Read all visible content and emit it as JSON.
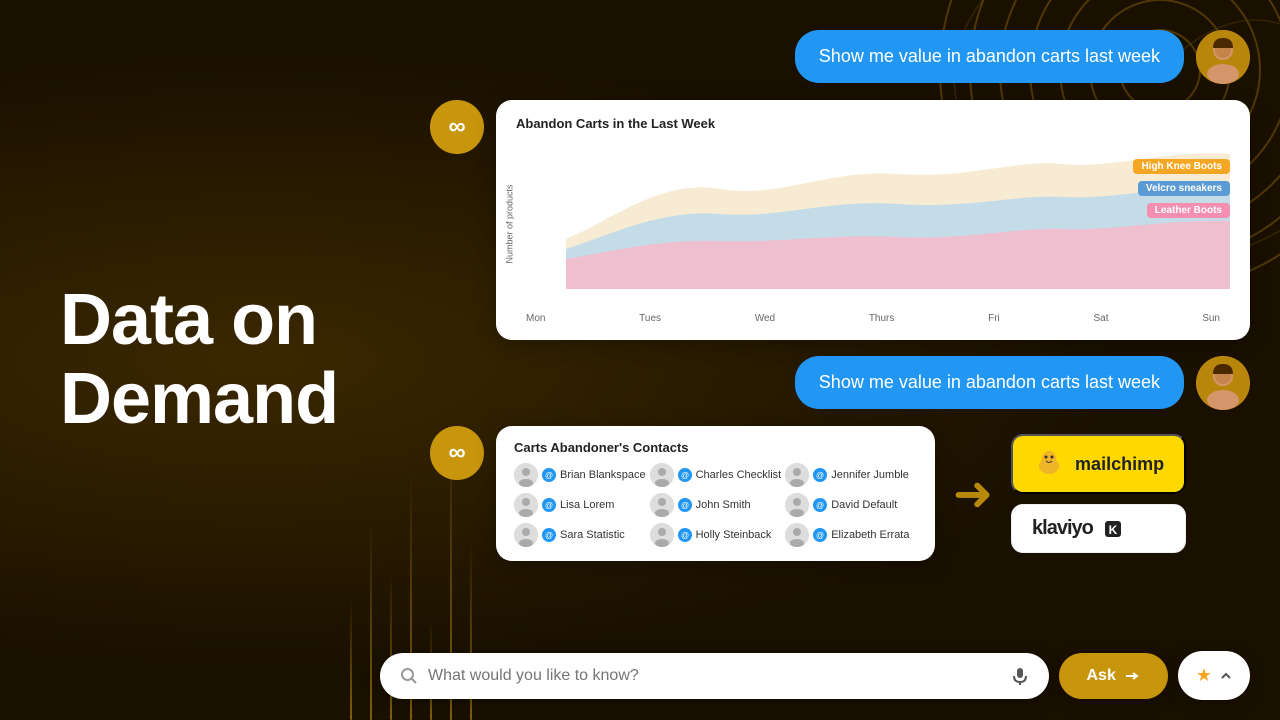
{
  "background": {
    "color1": "#1a1000",
    "color2": "#3a2800"
  },
  "hero": {
    "title": "Data on Demand"
  },
  "chat1": {
    "message": "Show me value in abandon carts last week"
  },
  "chat2": {
    "message": "Show me value in abandon carts last week"
  },
  "chart": {
    "title": "Abandon Carts in the Last Week",
    "y_label": "Number of products",
    "x_labels": [
      "Mon",
      "Tues",
      "Wed",
      "Thurs",
      "Fri",
      "Sat",
      "Sun"
    ],
    "legends": [
      {
        "name": "High Knee Boots",
        "color": "#f5a623"
      },
      {
        "name": "Velcro sneakers",
        "color": "#5b9bd5"
      },
      {
        "name": "Leather Boots",
        "color": "#f48fb1"
      }
    ]
  },
  "contacts": {
    "title": "Carts Abandoner's Contacts",
    "people": [
      {
        "name": "Brian Blankspace"
      },
      {
        "name": "Charles Checklist"
      },
      {
        "name": "Jennifer Jumble"
      },
      {
        "name": "Lisa Lorem"
      },
      {
        "name": "John Smith"
      },
      {
        "name": "David Default"
      },
      {
        "name": "Sara Statistic"
      },
      {
        "name": "Holly Steinback"
      },
      {
        "name": "Elizabeth Errata"
      }
    ]
  },
  "integrations": [
    {
      "name": "mailchimp",
      "label": "mailchimp",
      "bg": "#ffd800"
    },
    {
      "name": "klaviyo",
      "label": "klaviyo",
      "bg": "#ffffff"
    }
  ],
  "searchbar": {
    "placeholder": "What would you like to know?",
    "ask_label": "Ask",
    "star_label": "★",
    "chevron_label": "^"
  }
}
